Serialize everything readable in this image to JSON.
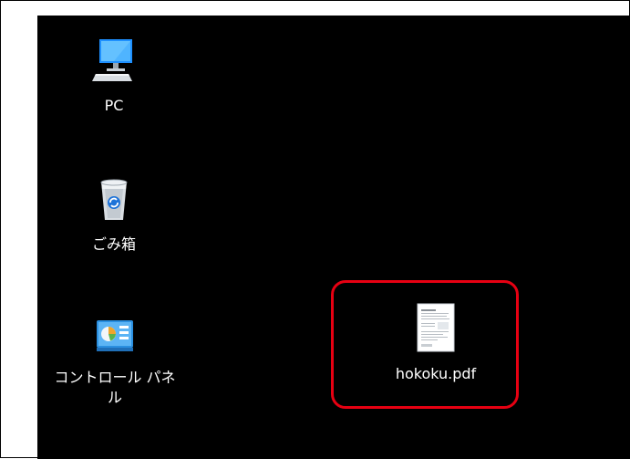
{
  "desktop": {
    "icons": [
      {
        "name": "pc",
        "label": "PC",
        "icon": "computer-icon"
      },
      {
        "name": "recycle-bin",
        "label": "ごみ箱",
        "icon": "recycle-bin-icon"
      },
      {
        "name": "control-panel",
        "label": "コントロール パネル",
        "icon": "control-panel-icon"
      },
      {
        "name": "pdf-file",
        "label": "hokoku.pdf",
        "icon": "pdf-document-icon"
      }
    ]
  },
  "colors": {
    "desktop_background": "#000000",
    "highlight_border": "#e60012",
    "label_text": "#ffffff"
  }
}
